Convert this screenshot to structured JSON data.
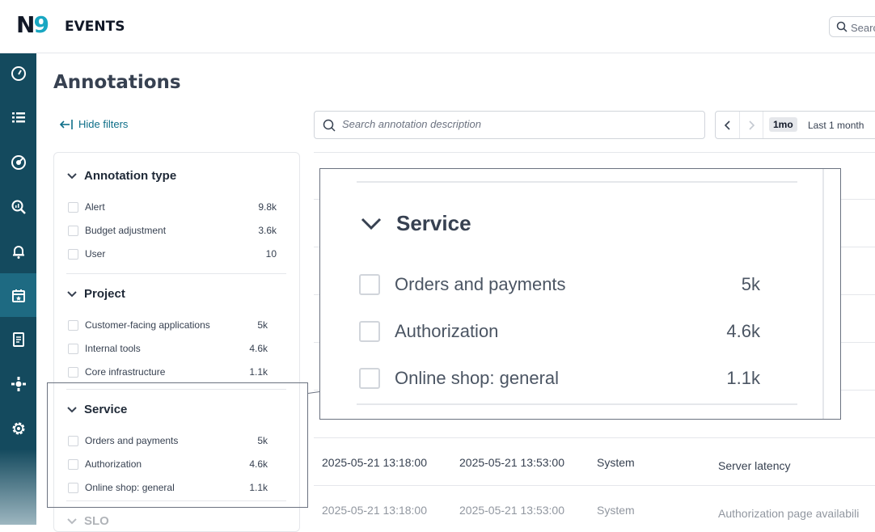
{
  "header": {
    "logo_n": "N",
    "logo_nine": "9",
    "title": "EVENTS",
    "search_placeholder": "Search"
  },
  "sidebar": {
    "items": [
      {
        "icon": "dashboard-gauge-icon"
      },
      {
        "icon": "list-icon"
      },
      {
        "icon": "slo-target-icon"
      },
      {
        "icon": "analyze-magnifier-icon"
      },
      {
        "icon": "alerts-bell-icon"
      },
      {
        "icon": "calendar-star-icon",
        "active": true
      },
      {
        "icon": "report-document-icon"
      },
      {
        "icon": "integrations-icon"
      },
      {
        "icon": "settings-gear-icon"
      }
    ]
  },
  "page": {
    "title": "Annotations",
    "hide_filters": "Hide filters"
  },
  "filters": {
    "annotation_type": {
      "title": "Annotation type",
      "items": [
        {
          "label": "Alert",
          "count": "9.8k"
        },
        {
          "label": "Budget adjustment",
          "count": "3.6k"
        },
        {
          "label": "User",
          "count": "10"
        }
      ]
    },
    "project": {
      "title": "Project",
      "items": [
        {
          "label": "Customer-facing applications",
          "count": "5k"
        },
        {
          "label": "Internal tools",
          "count": "4.6k"
        },
        {
          "label": "Core infrastructure",
          "count": "1.1k"
        }
      ]
    },
    "service": {
      "title": "Service",
      "items": [
        {
          "label": "Orders and payments",
          "count": "5k"
        },
        {
          "label": "Authorization",
          "count": "4.6k"
        },
        {
          "label": "Online shop: general",
          "count": "1.1k"
        }
      ]
    },
    "slo": {
      "title": "SLO"
    }
  },
  "search": {
    "placeholder": "Search annotation description"
  },
  "date_range": {
    "chip": "1mo",
    "label": "Last 1 month"
  },
  "table": {
    "rows": [
      {
        "start": "2025-05-21 13:18:00",
        "end": "2025-05-21 13:53:00",
        "source": "System",
        "description": "Server latency"
      },
      {
        "start": "2025-05-21 13:18:00",
        "end": "2025-05-21 13:53:00",
        "source": "System",
        "description": "Authorization page availabili"
      }
    ]
  }
}
